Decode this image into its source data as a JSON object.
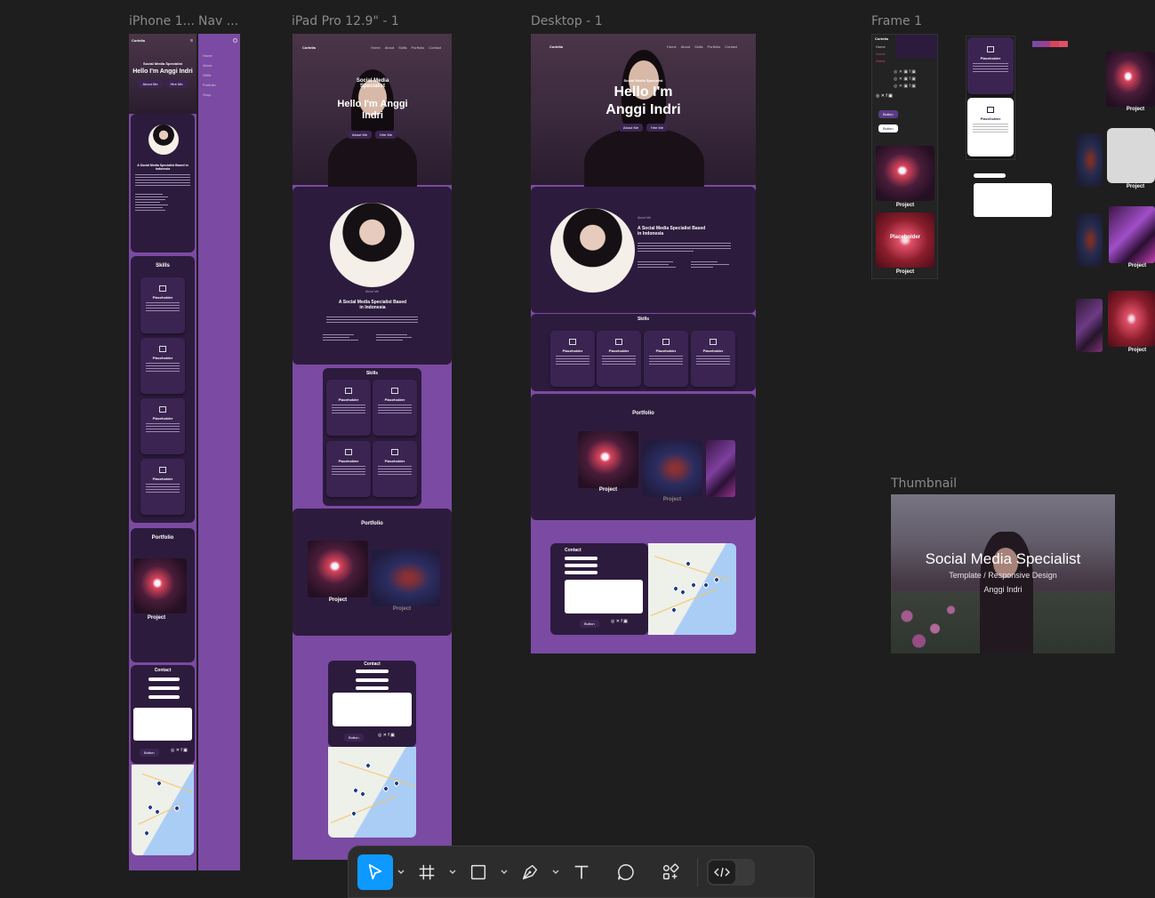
{
  "frames": {
    "iphone_label": "iPhone 1...",
    "nav_label": "Nav ...",
    "ipad_label": "iPad Pro 12.9\" - 1",
    "desktop_label": "Desktop - 1",
    "frame1_label": "Frame 1",
    "thumbnail_label": "Thumbnail"
  },
  "site": {
    "brand": "Cortelia",
    "hero_subtitle": "Social Media Specialist",
    "hero_title": "Hello I'm Anggi Indri",
    "hero_title_line1": "Hello I'm",
    "hero_title_line2": "Anggi Indri",
    "about_button": "About Me",
    "hire_button": "Hire Me",
    "nav_items": [
      "Home",
      "About",
      "Skills",
      "Portfolio",
      "Contact"
    ],
    "mobile_nav_items": [
      "Home",
      "About",
      "Skills",
      "Portfolio",
      "Shop"
    ],
    "about_small": "About Me",
    "about_heading": "A Social Media Specialist Based in Indonesia",
    "skills_heading": "Skills",
    "placeholder": "Placeholder",
    "portfolio_heading": "Portfolio",
    "project_label": "Project",
    "contact_heading": "Contact",
    "button_label": "Button"
  },
  "thumbnail": {
    "title": "Social Media Specialist",
    "subtitle": "Template / Responsive Design",
    "author": "Anggi Indri"
  },
  "colors": {
    "canvas": "#1e1e1e",
    "site_purple": "#7b4aa3",
    "panel": "#2d1b3d",
    "tool_active": "#0d99ff",
    "swatches": [
      "#7b4aa3",
      "#9c3f8f",
      "#d9435a",
      "#e05068"
    ]
  },
  "toolbar": {
    "tools": [
      "move-tool",
      "frame-tool",
      "shape-tool",
      "pen-tool",
      "text-tool",
      "comment-tool",
      "actions-tool",
      "dev-mode-toggle"
    ]
  }
}
